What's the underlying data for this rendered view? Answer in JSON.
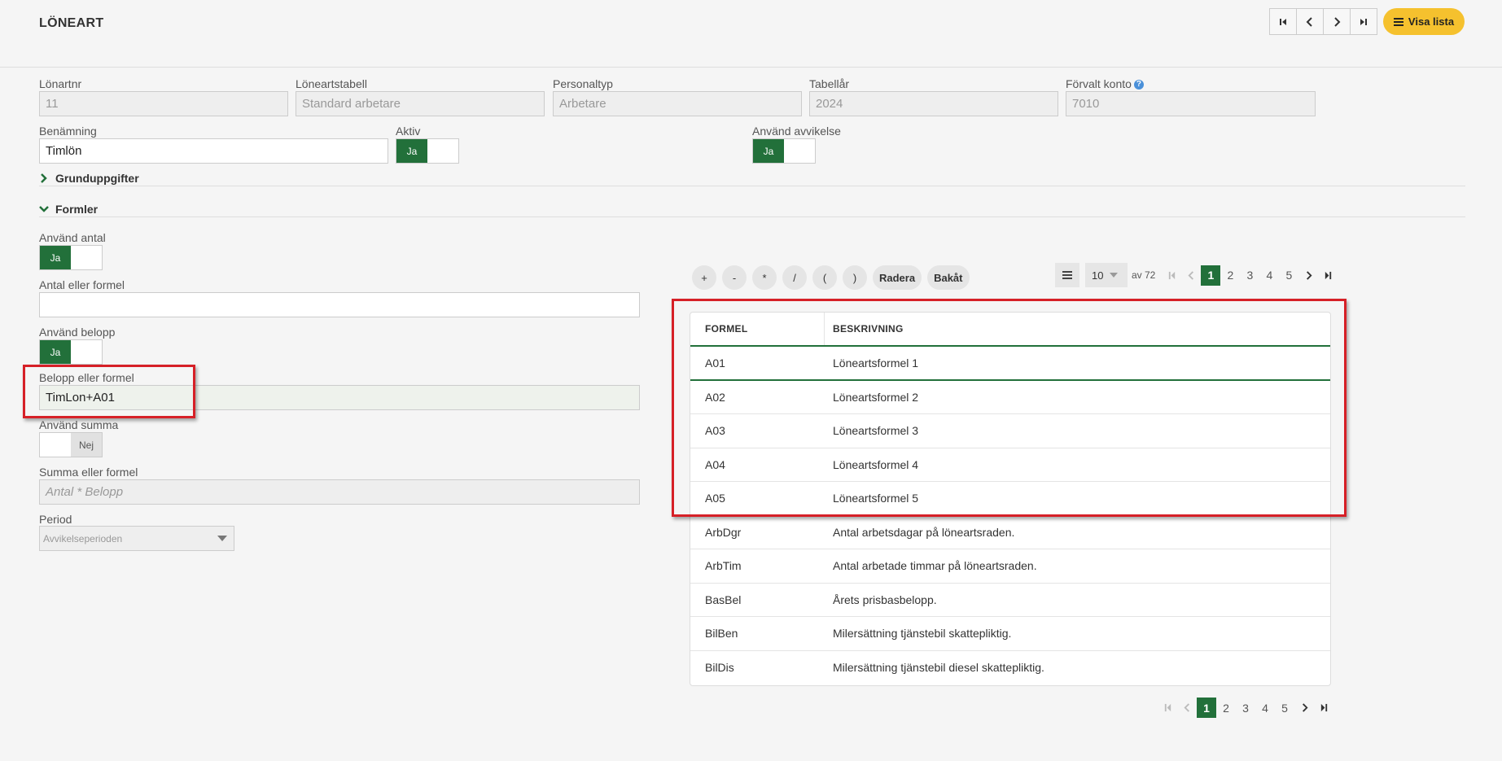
{
  "header": {
    "title": "LÖNEART",
    "visa_lista": "Visa lista"
  },
  "fields": {
    "lonartnr": {
      "label": "Lönartnr",
      "value": "11"
    },
    "loneartstabell": {
      "label": "Löneartstabell",
      "value": "Standard arbetare"
    },
    "personaltyp": {
      "label": "Personaltyp",
      "value": "Arbetare"
    },
    "tabellar": {
      "label": "Tabellår",
      "value": "2024"
    },
    "forvalt_konto": {
      "label": "Förvalt konto",
      "value": "7010",
      "help": "?"
    },
    "benamning": {
      "label": "Benämning",
      "value": "Timlön"
    },
    "aktiv": {
      "label": "Aktiv",
      "state": "Ja"
    },
    "anvand_avvikelse": {
      "label": "Använd avvikelse",
      "state": "Ja"
    }
  },
  "sections": {
    "grunduppgifter": "Grunduppgifter",
    "formler": "Formler"
  },
  "formler": {
    "anvand_antal": {
      "label": "Använd antal",
      "state": "Ja"
    },
    "antal_formel": {
      "label": "Antal eller formel",
      "value": ""
    },
    "anvand_belopp": {
      "label": "Använd belopp",
      "state": "Ja"
    },
    "belopp_formel": {
      "label": "Belopp eller formel",
      "value": "TimLon+A01"
    },
    "anvand_summa": {
      "label": "Använd summa",
      "state": "Nej"
    },
    "summa_formel": {
      "label": "Summa eller formel",
      "placeholder": "Antal * Belopp"
    },
    "period": {
      "label": "Period",
      "value": "Avvikelseperioden"
    }
  },
  "calculator": [
    "+",
    "-",
    "*",
    "/",
    "(",
    ")",
    "Radera",
    "Bakåt"
  ],
  "pager": {
    "page_size": "10",
    "of_text": "av 72",
    "pages": [
      "1",
      "2",
      "3",
      "4",
      "5"
    ],
    "active": "1"
  },
  "table": {
    "headers": [
      "FORMEL",
      "BESKRIVNING"
    ],
    "rows": [
      {
        "formel": "A01",
        "beskrivning": "Löneartsformel 1"
      },
      {
        "formel": "A02",
        "beskrivning": "Löneartsformel 2"
      },
      {
        "formel": "A03",
        "beskrivning": "Löneartsformel 3"
      },
      {
        "formel": "A04",
        "beskrivning": "Löneartsformel 4"
      },
      {
        "formel": "A05",
        "beskrivning": "Löneartsformel 5"
      },
      {
        "formel": "ArbDgr",
        "beskrivning": "Antal arbetsdagar på löneartsraden."
      },
      {
        "formel": "ArbTim",
        "beskrivning": "Antal arbetade timmar på löneartsraden."
      },
      {
        "formel": "BasBel",
        "beskrivning": "Årets prisbasbelopp."
      },
      {
        "formel": "BilBen",
        "beskrivning": "Milersättning tjänstebil skattepliktig."
      },
      {
        "formel": "BilDis",
        "beskrivning": "Milersättning tjänstebil diesel skattepliktig."
      }
    ]
  },
  "colors": {
    "accent": "#22703a",
    "button_yellow": "#f5c12e",
    "highlight": "#d62027"
  }
}
